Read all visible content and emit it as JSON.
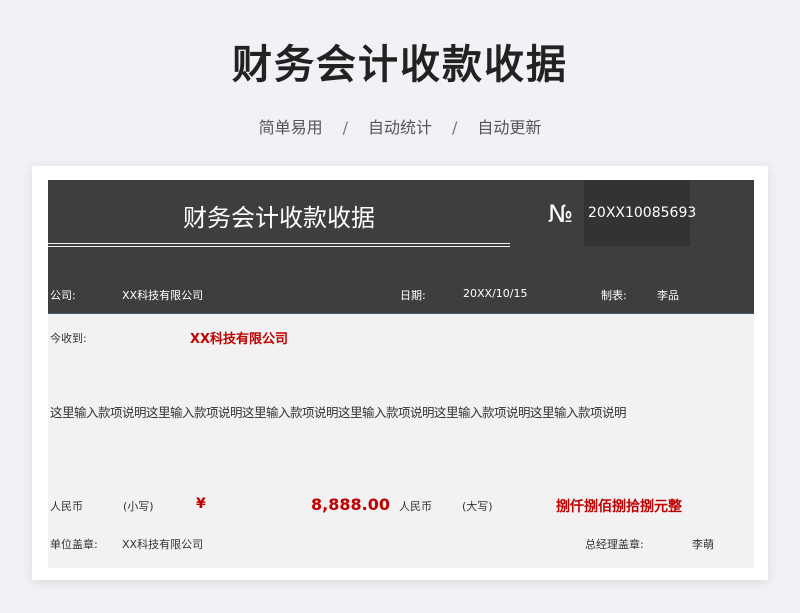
{
  "page": {
    "title": "财务会计收款收据",
    "tags": [
      "简单易用",
      "自动统计",
      "自动更新"
    ],
    "separator": "/"
  },
  "receipt": {
    "title": "财务会计收款收据",
    "no_symbol": "№",
    "number": "20XX10085693",
    "company_label": "公司:",
    "company_value": "XX科技有限公司",
    "date_label": "日期:",
    "date_value": "20XX/10/15",
    "maker_label": "制表:",
    "maker_value": "李品",
    "received_label": "今收到:",
    "received_from": "XX科技有限公司",
    "description": "这里输入款项说明这里输入款项说明这里输入款项说明这里输入款项说明这里输入款项说明这里输入款项说明",
    "rmb_label": "人民币",
    "lower_label": "(小写)",
    "currency_symbol": "¥",
    "amount": "8,888.00",
    "rmb_label2": "人民币",
    "upper_label": "(大写)",
    "amount_upper": "捌仟捌佰捌拾捌元整",
    "seal_label": "单位盖章:",
    "seal_value": "XX科技有限公司",
    "gm_seal_label": "总经理盖章:",
    "gm_name": "李萌"
  },
  "colors": {
    "header_bg": "#3e3e3e",
    "number_bg": "#333333",
    "accent_red": "#c00000",
    "sheet_bg": "#f2f2f2"
  }
}
